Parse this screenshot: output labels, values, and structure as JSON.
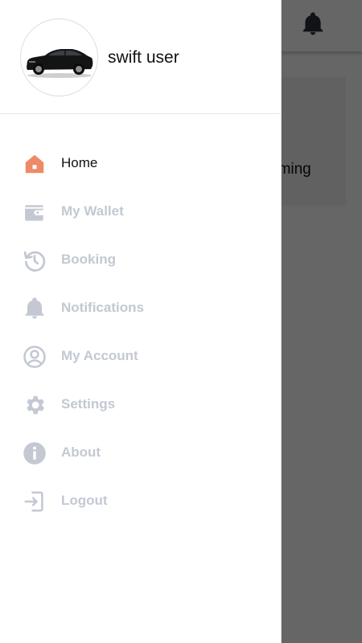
{
  "background": {
    "card_text": "oming"
  },
  "drawer": {
    "username": "swift user",
    "menu": [
      {
        "label": "Home",
        "icon": "home-icon",
        "active": true
      },
      {
        "label": "My Wallet",
        "icon": "wallet-icon",
        "active": false
      },
      {
        "label": "Booking",
        "icon": "history-icon",
        "active": false
      },
      {
        "label": "Notifications",
        "icon": "bell-icon",
        "active": false
      },
      {
        "label": "My Account",
        "icon": "account-icon",
        "active": false
      },
      {
        "label": "Settings",
        "icon": "gear-icon",
        "active": false
      },
      {
        "label": "About",
        "icon": "info-icon",
        "active": false
      },
      {
        "label": "Logout",
        "icon": "logout-icon",
        "active": false
      }
    ]
  },
  "colors": {
    "active_icon": "#ee8a67",
    "inactive": "#c3c8d3",
    "overlay": "#666666"
  }
}
